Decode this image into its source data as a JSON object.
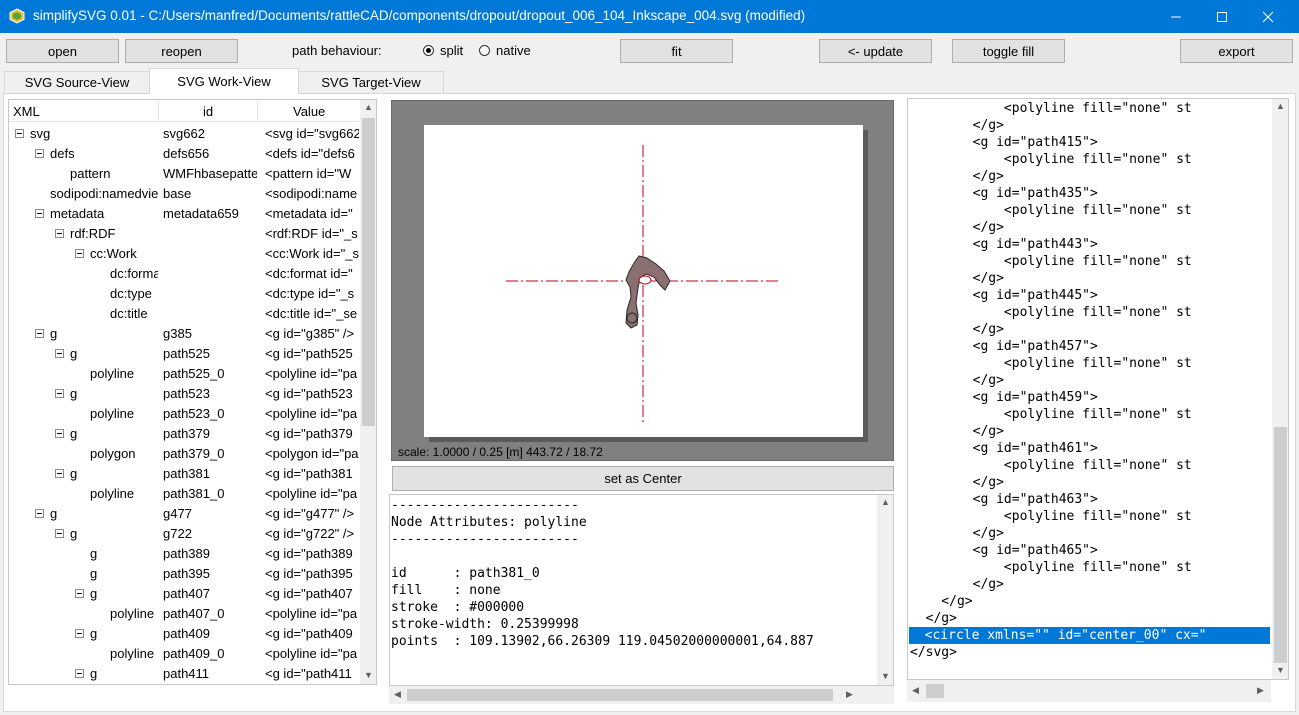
{
  "window": {
    "title": "simplifySVG 0.01 - C:/Users/manfred/Documents/rattleCAD/components/dropout/dropout_006_104_Inkscape_004.svg (modified)",
    "minimize": "—",
    "maximize": "☐",
    "close": "✕"
  },
  "toolbar": {
    "open": "open",
    "reopen": "reopen",
    "path_behaviour_label": "path behaviour:",
    "split": "split",
    "native": "native",
    "selected_mode": "split",
    "fit": "fit",
    "update": "<- update",
    "toggle_fill": "toggle fill",
    "export": "export"
  },
  "tabs": [
    {
      "label": "SVG Source-View",
      "active": false
    },
    {
      "label": "SVG Work-View",
      "active": true
    },
    {
      "label": "SVG Target-View",
      "active": false
    }
  ],
  "tree": {
    "headers": {
      "xml": "XML",
      "id": "id",
      "value": "Value"
    },
    "rows": [
      {
        "name": "svg",
        "id": "svg662",
        "value": "<svg id=\"svg662",
        "depth": 0,
        "expander": true
      },
      {
        "name": "defs",
        "id": "defs656",
        "value": "<defs id=\"defs6",
        "depth": 1,
        "expander": true
      },
      {
        "name": "pattern",
        "id": "WMFhbasepatte",
        "value": "<pattern id=\"W",
        "depth": 2,
        "expander": false
      },
      {
        "name": "sodipodi:namedvie",
        "id": "base",
        "value": "<sodipodi:name",
        "depth": 1,
        "expander": false
      },
      {
        "name": "metadata",
        "id": "metadata659",
        "value": "<metadata id=\"",
        "depth": 1,
        "expander": true
      },
      {
        "name": "rdf:RDF",
        "id": "",
        "value": "<rdf:RDF id=\"_s",
        "depth": 2,
        "expander": true
      },
      {
        "name": "cc:Work",
        "id": "",
        "value": "<cc:Work id=\"_s",
        "depth": 3,
        "expander": true
      },
      {
        "name": "dc:forma",
        "id": "",
        "value": "<dc:format id=\"",
        "depth": 4,
        "expander": false
      },
      {
        "name": "dc:type",
        "id": "",
        "value": "<dc:type id=\"_s",
        "depth": 4,
        "expander": false
      },
      {
        "name": "dc:title",
        "id": "",
        "value": "<dc:title id=\"_se",
        "depth": 4,
        "expander": false
      },
      {
        "name": "g",
        "id": "g385",
        "value": "<g id=\"g385\" />",
        "depth": 1,
        "expander": true
      },
      {
        "name": "g",
        "id": "path525",
        "value": "<g id=\"path525",
        "depth": 2,
        "expander": true
      },
      {
        "name": "polyline",
        "id": "path525_0",
        "value": "<polyline id=\"pa",
        "depth": 3,
        "expander": false
      },
      {
        "name": "g",
        "id": "path523",
        "value": "<g id=\"path523",
        "depth": 2,
        "expander": true
      },
      {
        "name": "polyline",
        "id": "path523_0",
        "value": "<polyline id=\"pa",
        "depth": 3,
        "expander": false
      },
      {
        "name": "g",
        "id": "path379",
        "value": "<g id=\"path379",
        "depth": 2,
        "expander": true
      },
      {
        "name": "polygon",
        "id": "path379_0",
        "value": "<polygon id=\"pa",
        "depth": 3,
        "expander": false
      },
      {
        "name": "g",
        "id": "path381",
        "value": "<g id=\"path381",
        "depth": 2,
        "expander": true
      },
      {
        "name": "polyline",
        "id": "path381_0",
        "value": "<polyline id=\"pa",
        "depth": 3,
        "expander": false
      },
      {
        "name": "g",
        "id": "g477",
        "value": "<g id=\"g477\" />",
        "depth": 1,
        "expander": true
      },
      {
        "name": "g",
        "id": "g722",
        "value": "<g id=\"g722\" />",
        "depth": 2,
        "expander": true
      },
      {
        "name": "g",
        "id": "path389",
        "value": "<g id=\"path389",
        "depth": 3,
        "expander": false
      },
      {
        "name": "g",
        "id": "path395",
        "value": "<g id=\"path395",
        "depth": 3,
        "expander": false
      },
      {
        "name": "g",
        "id": "path407",
        "value": "<g id=\"path407",
        "depth": 3,
        "expander": true
      },
      {
        "name": "polyline",
        "id": "path407_0",
        "value": "<polyline id=\"pa",
        "depth": 4,
        "expander": false
      },
      {
        "name": "g",
        "id": "path409",
        "value": "<g id=\"path409",
        "depth": 3,
        "expander": true
      },
      {
        "name": "polyline",
        "id": "path409_0",
        "value": "<polyline id=\"pa",
        "depth": 4,
        "expander": false
      },
      {
        "name": "g",
        "id": "path411",
        "value": "<g id=\"path411",
        "depth": 3,
        "expander": true
      }
    ]
  },
  "canvas": {
    "scale_text": "scale: 1.0000 / 0.25  [m]  443.72 / 18.72",
    "set_center": "set as Center"
  },
  "attributes": {
    "lines": [
      "------------------------",
      "Node Attributes: polyline",
      "------------------------",
      "",
      "id      : path381_0",
      "fill    : none",
      "stroke  : #000000",
      "stroke-width: 0.25399998",
      "points  : 109.13902,66.26309 119.04502000000001,64.887"
    ]
  },
  "source": {
    "lines": [
      "            <polyline fill=\"none\" st",
      "        </g>",
      "        <g id=\"path415\">",
      "            <polyline fill=\"none\" st",
      "        </g>",
      "        <g id=\"path435\">",
      "            <polyline fill=\"none\" st",
      "        </g>",
      "        <g id=\"path443\">",
      "            <polyline fill=\"none\" st",
      "        </g>",
      "        <g id=\"path445\">",
      "            <polyline fill=\"none\" st",
      "        </g>",
      "        <g id=\"path457\">",
      "            <polyline fill=\"none\" st",
      "        </g>",
      "        <g id=\"path459\">",
      "            <polyline fill=\"none\" st",
      "        </g>",
      "        <g id=\"path461\">",
      "            <polyline fill=\"none\" st",
      "        </g>",
      "        <g id=\"path463\">",
      "            <polyline fill=\"none\" st",
      "        </g>",
      "        <g id=\"path465\">",
      "            <polyline fill=\"none\" st",
      "        </g>",
      "    </g>",
      "  </g>",
      "  <circle xmlns=\"\" id=\"center_00\" cx=\"",
      "</svg>"
    ],
    "selected_index": 31
  },
  "colors": {
    "accent": "#0078d7",
    "crosshair": "#c0001a",
    "shape_fill": "#8a7070"
  }
}
